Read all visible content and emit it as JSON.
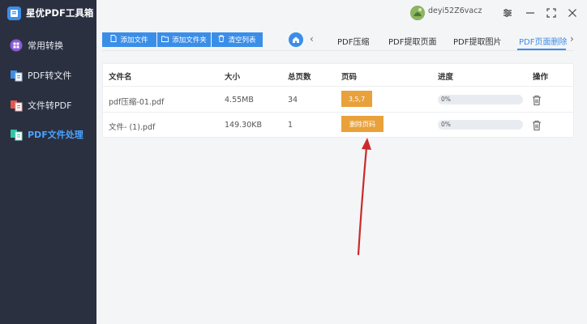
{
  "app": {
    "title": "星优PDF工具箱",
    "user": "deyi52Z6vacz"
  },
  "sidebar": {
    "items": [
      {
        "label": "常用转换"
      },
      {
        "label": "PDF转文件"
      },
      {
        "label": "文件转PDF"
      },
      {
        "label": "PDF文件处理",
        "active": true
      }
    ]
  },
  "toolbar": {
    "add_file": "添加文件",
    "add_folder": "添加文件夹",
    "clear_list": "清空列表"
  },
  "tabs": [
    {
      "label": "PDF压缩"
    },
    {
      "label": "PDF提取页面"
    },
    {
      "label": "PDF提取图片"
    },
    {
      "label": "PDF页面删除",
      "active": true
    }
  ],
  "table": {
    "headers": {
      "name": "文件名",
      "size": "大小",
      "pages": "总页数",
      "page_code": "页码",
      "progress": "进度",
      "action": "操作"
    },
    "rows": [
      {
        "name": "pdf压缩-01.pdf",
        "size": "4.55MB",
        "pages": "34",
        "page_code": "3,5,7",
        "progress_text": "0%",
        "progress": 0
      },
      {
        "name": "文件- (1).pdf",
        "size": "149.30KB",
        "pages": "1",
        "page_code": "删除页码",
        "progress_text": "0%",
        "progress": 0
      }
    ]
  },
  "colors": {
    "sidebar_bg": "#2b3040",
    "accent": "#3b8ee8",
    "page_button": "#e9a13b",
    "arrow": "#cc2a2a"
  }
}
